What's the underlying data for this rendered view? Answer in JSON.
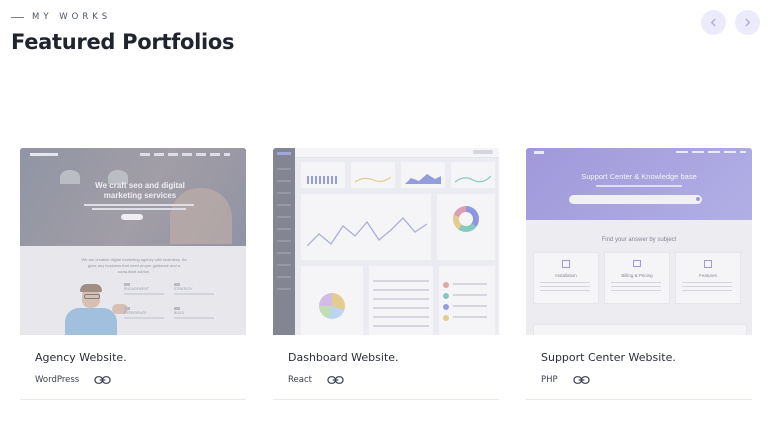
{
  "header": {
    "eyebrow": "MY WORKS",
    "title": "Featured Portfolios"
  },
  "nav": {
    "prev_icon": "chevron-left-icon",
    "next_icon": "chevron-right-icon"
  },
  "cards": [
    {
      "title": "Agency Website.",
      "tech": "WordPress",
      "preview": {
        "hero_heading": "We craft seo and digital marketing services",
        "body_text": "We are creative digital marketing agency with seamless. As goes any business that need proper guidance and a consultant advice.",
        "features": [
          "ENGAGEMENT",
          "STRATEGY",
          "EXPERIENCE",
          "BUILD"
        ]
      }
    },
    {
      "title": "Dashboard Website.",
      "tech": "React",
      "preview": {}
    },
    {
      "title": "Support Center Website.",
      "tech": "PHP",
      "preview": {
        "hero_heading": "Support Center & Knowledge base",
        "subheading": "Find your answer by subject",
        "topics": [
          "Installation",
          "Billing & Pricing",
          "Features"
        ]
      }
    }
  ],
  "colors": {
    "accent": "#6f69d6",
    "nav_bg": "#ecebfb",
    "title": "#20242e"
  }
}
